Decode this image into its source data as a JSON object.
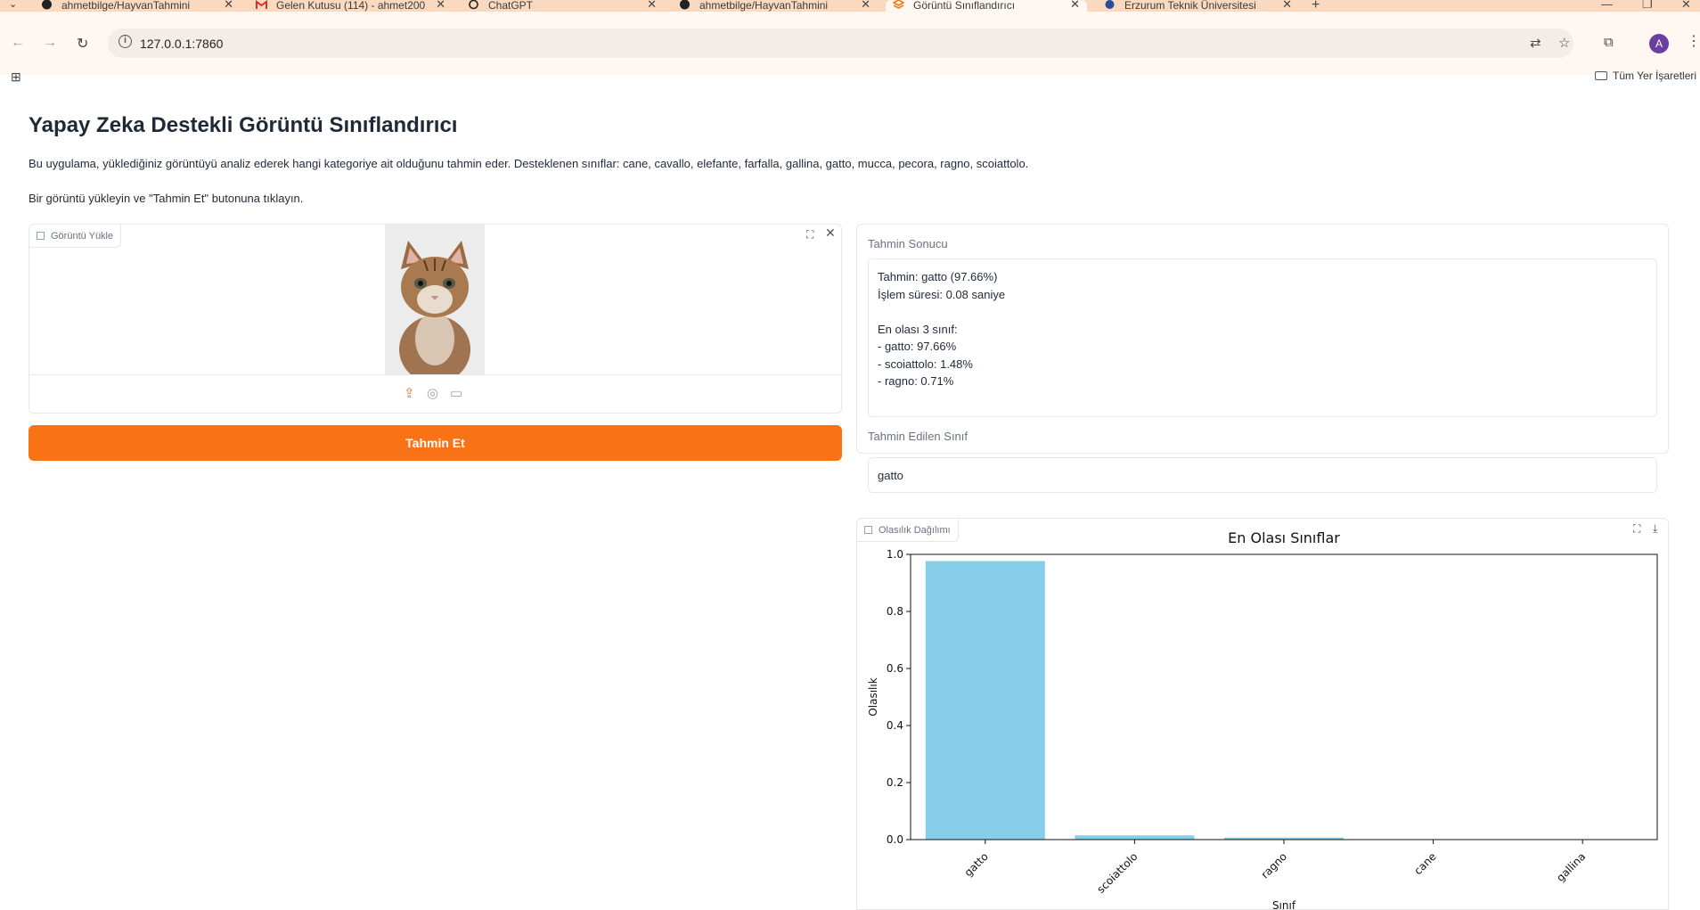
{
  "browser": {
    "tabs": [
      {
        "title": "ahmetbilge/HayvanTahmini",
        "icon": "github-icon"
      },
      {
        "title": "Gelen Kutusu (114) - ahmet200",
        "icon": "gmail-icon"
      },
      {
        "title": "ChatGPT",
        "icon": "chatgpt-icon"
      },
      {
        "title": "ahmetbilge/HayvanTahmini",
        "icon": "github-icon"
      },
      {
        "title": "Görüntü Sınıflandırıcı",
        "icon": "gradio-icon",
        "active": true
      },
      {
        "title": "Erzurum Teknik Üniversitesi",
        "icon": "university-icon"
      }
    ],
    "url": "127.0.0.1:7860",
    "avatar_letter": "A",
    "bookmarks_label": "Tüm Yer İşaretleri"
  },
  "page": {
    "title": "Yapay Zeka Destekli Görüntü Sınıflandırıcı",
    "description": "Bu uygulama, yüklediğiniz görüntüyü analiz ederek hangi kategoriye ait olduğunu tahmin eder. Desteklenen sınıflar: cane, cavallo, elefante, farfalla, gallina, gatto, mucca, pecora, ragno, scoiattolo.",
    "instruction": "Bir görüntü yükleyin ve \"Tahmin Et\" butonuna tıklayın.",
    "upload_label": "Görüntü Yükle",
    "predict_button": "Tahmin Et",
    "result_label": "Tahmin Sonucu",
    "result_text": "Tahmin: gatto (97.66%)\nİşlem süresi: 0.08 saniye\n\nEn olası 3 sınıf:\n- gatto: 97.66%\n- scoiattolo: 1.48%\n- ragno: 0.71%",
    "predicted_class_label": "Tahmin Edilen Sınıf",
    "predicted_class": "gatto",
    "plot_label": "Olasılık Dağılımı"
  },
  "chart_data": {
    "type": "bar",
    "title": "En Olası Sınıflar",
    "xlabel": "Sınıf",
    "ylabel": "Olasılık",
    "categories": [
      "gatto",
      "scoiattolo",
      "ragno",
      "cane",
      "gallina"
    ],
    "values": [
      0.9766,
      0.0148,
      0.0071,
      0.0,
      0.0
    ],
    "ylim": [
      0,
      1.0
    ],
    "yticks": [
      0.0,
      0.2,
      0.4,
      0.6,
      0.8,
      1.0
    ],
    "bar_color": "#87ceeb",
    "grid": false
  },
  "colors": {
    "accent": "#f97316",
    "chrome": "#fbd9bf"
  }
}
